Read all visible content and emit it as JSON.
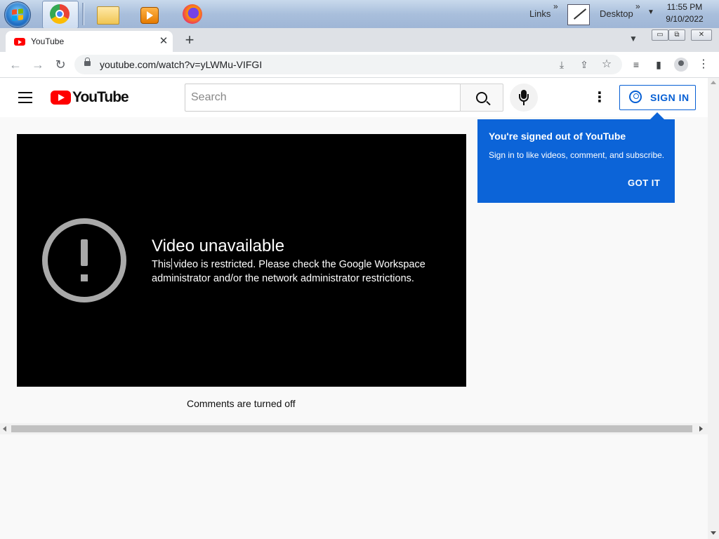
{
  "taskbar": {
    "apps": [
      "start-orb",
      "chrome-icon",
      "file-explorer-icon",
      "media-player-icon",
      "firefox-icon"
    ],
    "links_label": "Links",
    "desktop_label": "Desktop",
    "chevron": "»",
    "time": "11:55 PM",
    "date": "9/10/2022"
  },
  "browser": {
    "tab_title": "YouTube",
    "tab_close": "✕",
    "new_tab": "+",
    "tab_search": "⌄",
    "window_controls": {
      "minimize": "▭",
      "restore": "⧉",
      "close": "✕"
    },
    "url": "youtube.com/watch?v=yLWMu-VIFGI",
    "nav": {
      "back": "←",
      "forward": "→",
      "reload": "↻"
    },
    "omnibox_icons": {
      "install": "⤓",
      "share": "⇪",
      "bookmark": "☆"
    },
    "toolbar_icons": {
      "media": "≡",
      "side_panel": "▮",
      "menu": "⋮"
    }
  },
  "youtube": {
    "logo_text": "YouTube",
    "search": {
      "placeholder": "Search",
      "value": ""
    },
    "more_label": "⋮",
    "sign_in_label": "SIGN IN",
    "tooltip": {
      "title": "You're signed out of YouTube",
      "body": "Sign in to like videos, comment, and subscribe.",
      "button": "GOT IT"
    },
    "player": {
      "error_title": "Video unavailable",
      "error_message": "This video is restricted. Please check the Google Workspace administrator and/or the network administrator restrictions."
    },
    "comments_status": "Comments are turned off"
  },
  "colors": {
    "brand_red": "#ff0000",
    "accent_blue": "#065fd4",
    "tooltip_blue": "#0c64d8",
    "player_bg": "#000000"
  }
}
